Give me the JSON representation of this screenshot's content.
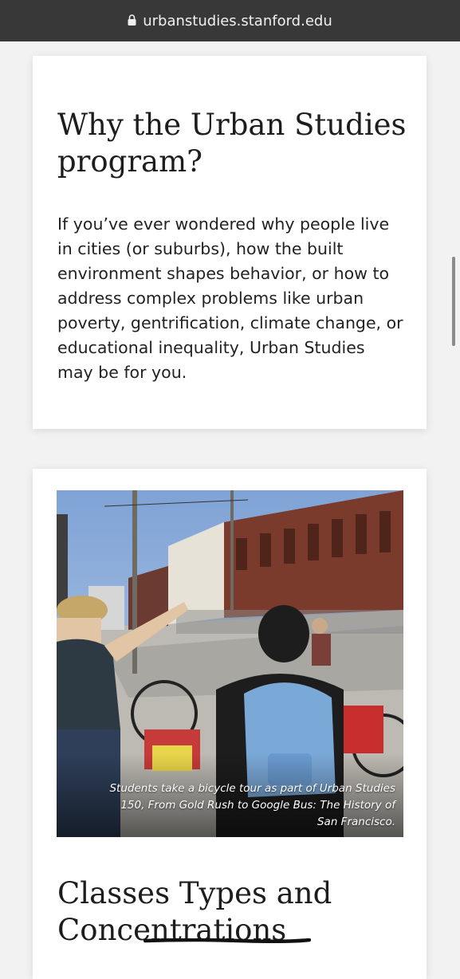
{
  "browser": {
    "url": "urbanstudies.stanford.edu",
    "lock_icon": "lock-icon"
  },
  "intro_card": {
    "heading": "Why the Urban Studies program?",
    "body": "If you’ve ever wondered why people live in cities (or suburbs), how the built environment shapes behavior, or how to address complex problems like urban poverty, gentrification, climate change, or educational inequality, Urban Studies may be for you."
  },
  "photo_card": {
    "caption": "Students take a bicycle tour as part of Urban Studies 150, From Gold Rush to Google Bus: The History of San Francisco.",
    "heading": "Classes Types and Concentrations"
  },
  "colors": {
    "url_bar": "#383838",
    "page_bg": "#f2f2f2",
    "card_bg": "#ffffff",
    "text": "#1d1d1d"
  }
}
